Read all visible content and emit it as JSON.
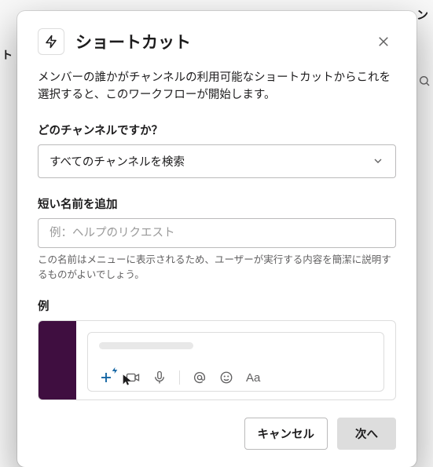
{
  "partial": {
    "top_right": "ン",
    "left": "ト"
  },
  "modal": {
    "title": "ショートカット",
    "description": "メンバーの誰かがチャンネルの利用可能なショートカットからこれを選択すると、このワークフローが開始します。",
    "channel": {
      "label": "どのチャンネルですか？",
      "selected": "すべてのチャンネルを検索"
    },
    "name": {
      "label": "短い名前を追加",
      "placeholder": "例：ヘルプのリクエスト",
      "help": "この名前はメニューに表示されるため、ユーザーが実行する内容を簡潔に説明するものがよいでしょう。"
    },
    "example_label": "例",
    "footer": {
      "cancel": "キャンセル",
      "next": "次へ"
    }
  }
}
